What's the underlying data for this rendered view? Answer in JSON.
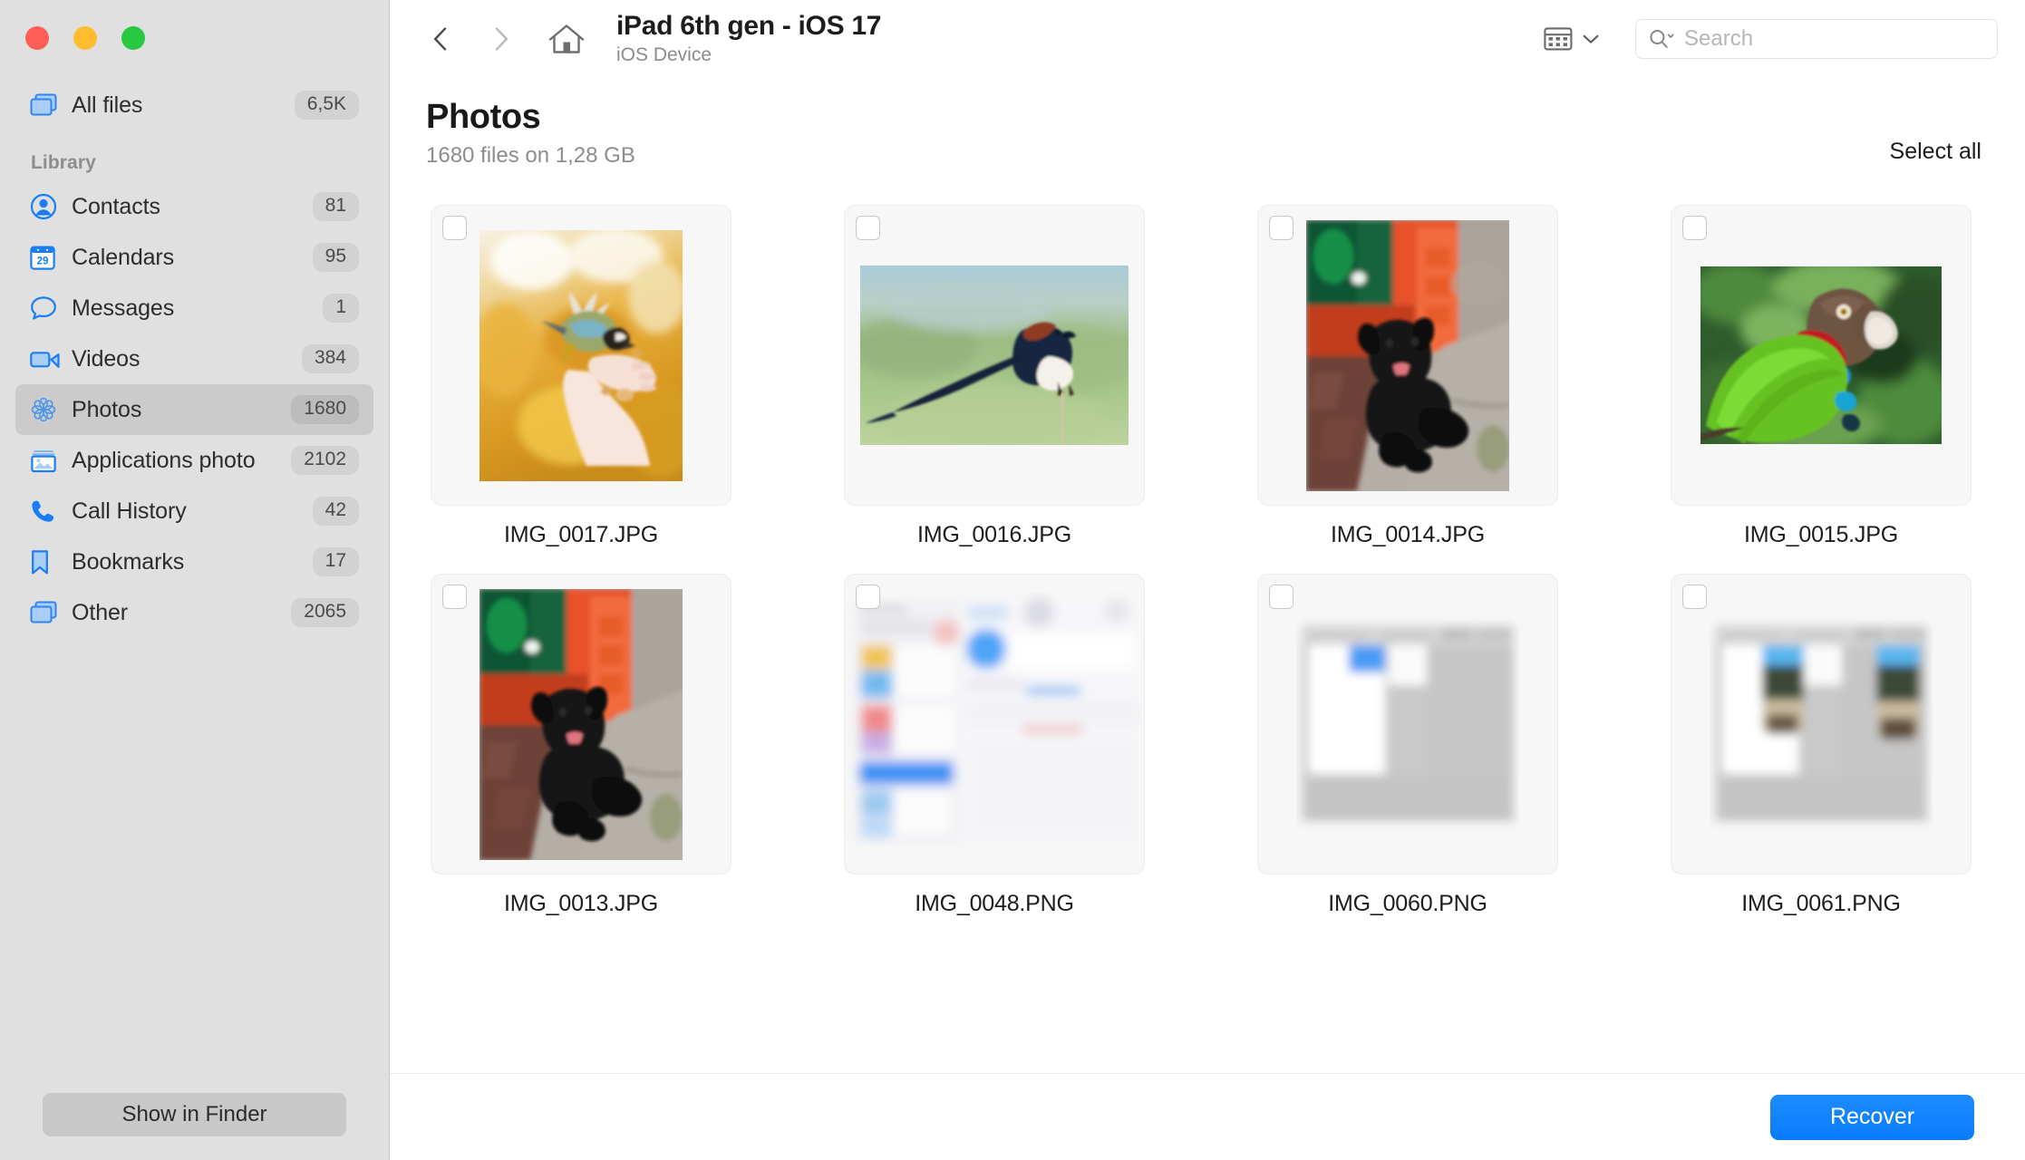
{
  "window": {
    "traffic_lights": [
      "close",
      "minimize",
      "zoom"
    ],
    "colors": {
      "close": "#ff5f57",
      "minimize": "#febc2e",
      "zoom": "#28c840",
      "accent": "#0a7cfb",
      "sidebar_bg": "#e0e0e0",
      "selected_row": "#cbcbcb"
    }
  },
  "sidebar": {
    "all_files": {
      "label": "All files",
      "count": "6,5K",
      "icon": "stacked-windows-icon"
    },
    "section_label": "Library",
    "items": [
      {
        "label": "Contacts",
        "count": "81",
        "icon": "contacts-icon"
      },
      {
        "label": "Calendars",
        "count": "95",
        "icon": "calendar-icon"
      },
      {
        "label": "Messages",
        "count": "1",
        "icon": "message-bubble-icon"
      },
      {
        "label": "Videos",
        "count": "384",
        "icon": "video-camera-icon"
      },
      {
        "label": "Photos",
        "count": "1680",
        "icon": "photos-flower-icon",
        "selected": true
      },
      {
        "label": "Applications photo",
        "count": "2102",
        "icon": "picture-frame-icon"
      },
      {
        "label": "Call History",
        "count": "42",
        "icon": "phone-icon"
      },
      {
        "label": "Bookmarks",
        "count": "17",
        "icon": "bookmark-icon"
      },
      {
        "label": "Other",
        "count": "2065",
        "icon": "stacked-windows-icon"
      }
    ],
    "show_in_finder": "Show in Finder"
  },
  "toolbar": {
    "back_icon": "chevron-left-icon",
    "forward_icon": "chevron-right-icon",
    "home_icon": "home-icon",
    "title": "iPad 6th gen - iOS 17",
    "subtitle": "iOS Device",
    "view_icon": "grid-view-icon",
    "view_chevron_icon": "chevron-down-icon",
    "search": {
      "icon": "search-icon",
      "placeholder": "Search",
      "value": ""
    }
  },
  "page": {
    "title": "Photos",
    "subtitle": "1680 files on 1,28 GB",
    "select_all": "Select all"
  },
  "grid": {
    "items": [
      {
        "filename": "IMG_0017.JPG",
        "kind": "photo",
        "art": "bird-on-hand",
        "orientation": "portrait",
        "checked": false
      },
      {
        "filename": "IMG_0016.JPG",
        "kind": "photo",
        "art": "swallow-on-perch",
        "orientation": "landscape",
        "checked": false
      },
      {
        "filename": "IMG_0014.JPG",
        "kind": "photo",
        "art": "black-puppy",
        "orientation": "portrait",
        "checked": false
      },
      {
        "filename": "IMG_0015.JPG",
        "kind": "photo",
        "art": "green-parrot",
        "orientation": "landscape",
        "checked": false
      },
      {
        "filename": "IMG_0013.JPG",
        "kind": "photo",
        "art": "black-puppy",
        "orientation": "portrait",
        "checked": false
      },
      {
        "filename": "IMG_0048.PNG",
        "kind": "screenshot",
        "art": "settings-screenshot",
        "orientation": "portrait",
        "checked": false
      },
      {
        "filename": "IMG_0060.PNG",
        "kind": "screenshot",
        "art": "app-screenshot-light",
        "orientation": "portrait",
        "checked": false
      },
      {
        "filename": "IMG_0061.PNG",
        "kind": "screenshot",
        "art": "app-screenshot-media",
        "orientation": "portrait",
        "checked": false
      }
    ]
  },
  "footer": {
    "recover": "Recover"
  }
}
